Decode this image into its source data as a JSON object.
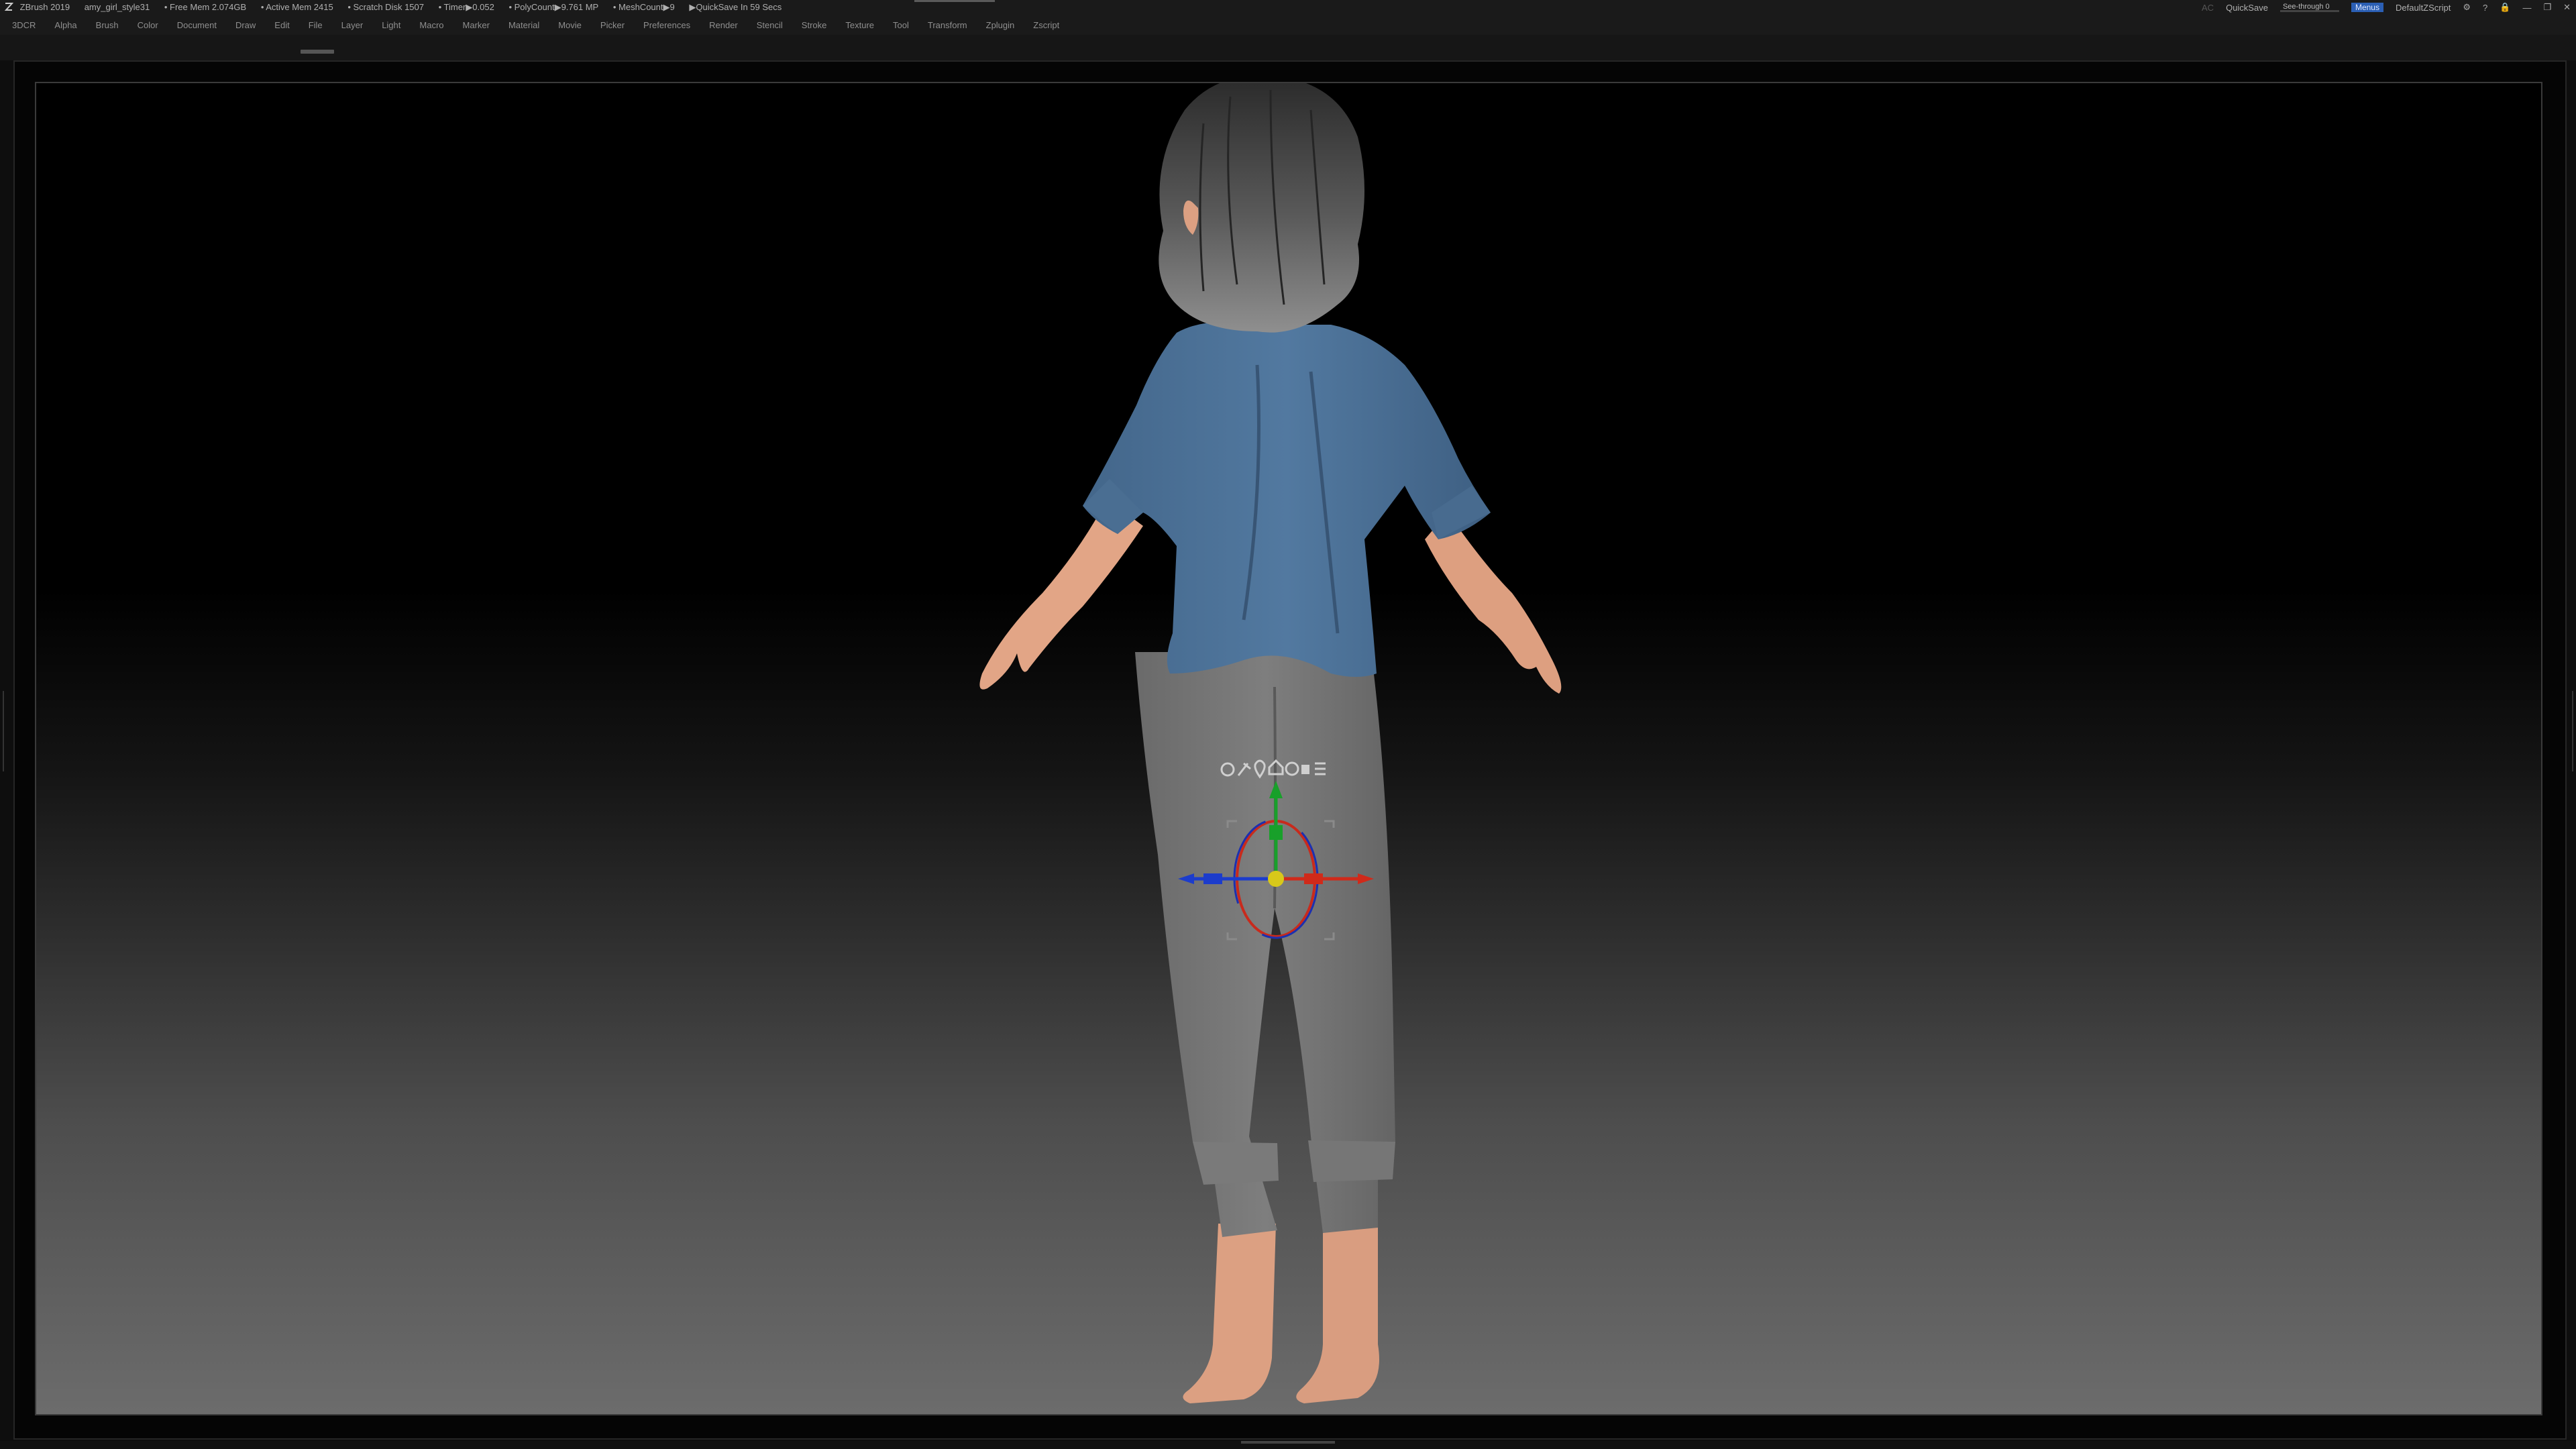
{
  "titlebar": {
    "app_title": "ZBrush 2019",
    "document_name": "amy_girl_style31",
    "free_mem": "• Free Mem 2.074GB",
    "active_mem": "• Active Mem 2415",
    "scratch_disk": "• Scratch Disk 1507",
    "timer": "• Timer▶0.052",
    "polycount": "• PolyCount▶9.761 MP",
    "meshcount": "• MeshCount▶9",
    "quicksave_timer": "▶QuickSave In 59 Secs",
    "ac_label": "AC",
    "quicksave_button": "QuickSave",
    "see_through_label": "See-through 0",
    "see_through_value": 0,
    "menus_button": "Menus",
    "default_script": "DefaultZScript"
  },
  "menubar": {
    "items": [
      "3DCR",
      "Alpha",
      "Brush",
      "Color",
      "Document",
      "Draw",
      "Edit",
      "File",
      "Layer",
      "Light",
      "Macro",
      "Marker",
      "Material",
      "Movie",
      "Picker",
      "Preferences",
      "Render",
      "Stencil",
      "Stroke",
      "Texture",
      "Tool",
      "Transform",
      "Zplugin",
      "Zscript"
    ]
  },
  "gizmo": {
    "icons": [
      "gear-icon",
      "pin-icon",
      "location-icon",
      "home-icon",
      "mask-icon",
      "lock-icon",
      "menu-icon"
    ],
    "axis_colors": {
      "x": "#d02a1a",
      "y": "#18a02a",
      "z": "#1c3ccc",
      "center": "#d8c81a"
    }
  },
  "colors": {
    "shirt": "#4f7396",
    "pants": "#737373",
    "hair": "#3c3c3c",
    "skin": "#e0a585",
    "menus_highlight": "#2b5fb4",
    "see_through_fill": "#e6b82c"
  }
}
